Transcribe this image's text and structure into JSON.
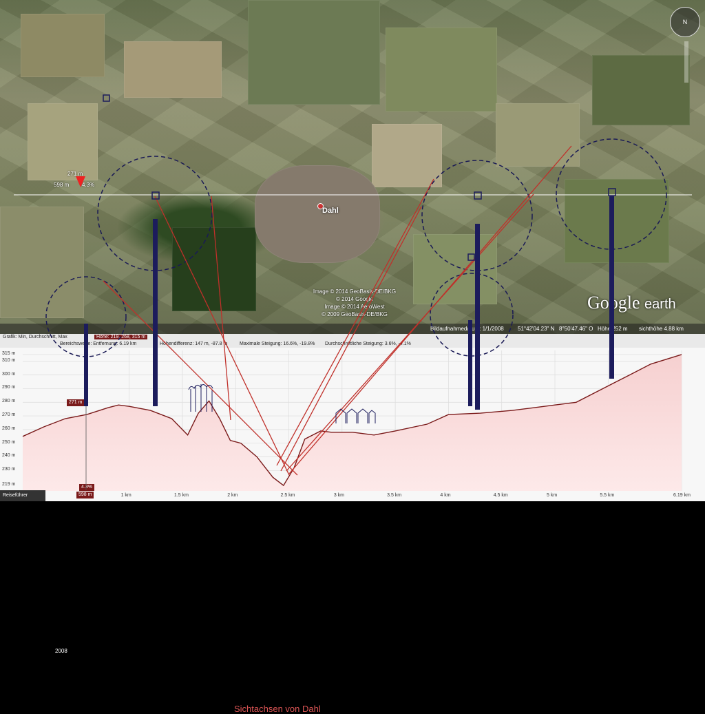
{
  "map": {
    "town_label": "Dahl",
    "copyright_lines": [
      "Image © 2014 GeoBasis-DE/BKG",
      "© 2014 Google",
      "Image © 2014 AeroWest",
      "© 2009 GeoBasis-DE/BKG"
    ],
    "logo_main": "Google",
    "logo_sub": "earth",
    "marker_altitude": "271 m",
    "marker_distance": "598 m",
    "marker_grade": "4.3%",
    "year_badge": "2008"
  },
  "statusbar": {
    "imagery_date": "Bildaufnahmedatum: 1/1/2008",
    "lat": "51°42'04.23\" N",
    "lon": "8°50'47.46\" O",
    "elevation": "Höhe 252 m",
    "eye_alt": "sichthöhe 4.88 km"
  },
  "graph": {
    "info_line1_left": "Grafik: Min, Durchschnitt, Max",
    "info_line1_highlight": "Höhe: 219, 268, 315 m",
    "info_line2_left": "Bereichswerte: Entfernung: 6.19 km",
    "info_line2_mid": "Höhendifferenz: 147 m, -87.8 m",
    "info_line2_slope": "Maximale Steigung: 16.6%, -19.8%",
    "info_line2_avg": "Durchschnittliche Steigung: 3.6%, -4.1%",
    "annotation": "Sichtachsen von Dahl",
    "cursor_value": "271 m",
    "cursor_grade": "4.3%",
    "cursor_distance": "598 m",
    "tour_button": "Reiseführer"
  },
  "chart_data": {
    "type": "area",
    "title": "",
    "xlabel": "",
    "ylabel": "",
    "xlim": [
      0,
      6.19
    ],
    "ylim": [
      215,
      318
    ],
    "y_ticks": [
      "315 m",
      "310 m",
      "300 m",
      "290 m",
      "280 m",
      "270 m",
      "260 m",
      "250 m",
      "240 m",
      "230 m",
      "219 m"
    ],
    "y_tick_values": [
      315,
      310,
      300,
      290,
      280,
      270,
      260,
      250,
      240,
      230,
      219
    ],
    "x_ticks": [
      "1 km",
      "1.5 km",
      "2 km",
      "2.5 km",
      "3 km",
      "3.5 km",
      "4 km",
      "4.5 km",
      "5 km",
      "5.5 km",
      "6.19 km"
    ],
    "x_tick_values": [
      1,
      1.5,
      2,
      2.5,
      3,
      3.5,
      4,
      4.5,
      5,
      5.5,
      6.19
    ],
    "series": [
      {
        "x": [
          0,
          0.2,
          0.4,
          0.6,
          0.8,
          0.9,
          1.0,
          1.2,
          1.4,
          1.55,
          1.65,
          1.75,
          1.85,
          1.95,
          2.05,
          2.2,
          2.35,
          2.45,
          2.55,
          2.65,
          2.8,
          2.9,
          3.1,
          3.3,
          3.5,
          3.8,
          4.0,
          4.3,
          4.6,
          4.8,
          5.0,
          5.2,
          5.5,
          5.7,
          5.9,
          6.19
        ],
        "y": [
          255,
          262,
          268,
          271,
          276,
          278,
          277,
          274,
          268,
          256,
          272,
          281,
          268,
          252,
          250,
          240,
          225,
          219,
          232,
          253,
          259,
          258,
          258,
          256,
          259,
          264,
          271,
          272,
          274,
          276,
          278,
          280,
          292,
          300,
          308,
          315
        ]
      }
    ]
  }
}
